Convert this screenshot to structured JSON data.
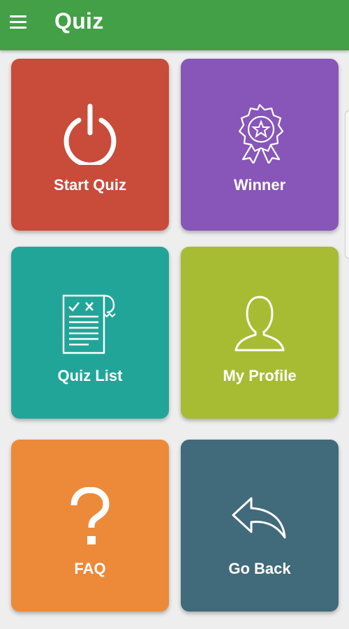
{
  "app_bar": {
    "title": "Quiz",
    "menu_icon": "hamburger-menu-icon",
    "color": "#43a047"
  },
  "tiles": [
    {
      "label": "Start Quiz",
      "icon": "power-icon",
      "color": "#c94b3a"
    },
    {
      "label": "Winner",
      "icon": "award-ribbon-icon",
      "color": "#8756b8"
    },
    {
      "label": "Quiz List",
      "icon": "checklist-document-icon",
      "color": "#22a599"
    },
    {
      "label": "My Profile",
      "icon": "user-profile-icon",
      "color": "#a8bc33"
    },
    {
      "label": "FAQ",
      "icon": "question-mark-icon",
      "color": "#ec8a3a"
    },
    {
      "label": "Go Back",
      "icon": "back-arrow-icon",
      "color": "#416a7a"
    }
  ]
}
